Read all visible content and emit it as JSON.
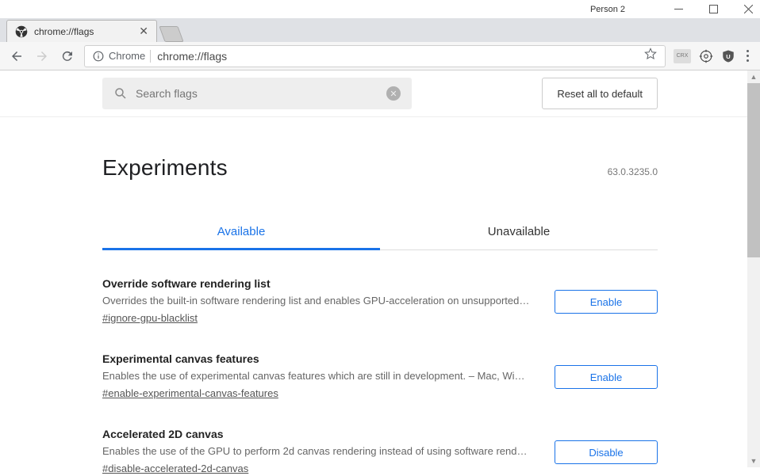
{
  "window": {
    "profile_label": "Person 2"
  },
  "tab": {
    "title": "chrome://flags"
  },
  "addressbar": {
    "origin_label": "Chrome",
    "url": "chrome://flags"
  },
  "search": {
    "placeholder": "Search flags"
  },
  "reset_button": "Reset all to default",
  "page": {
    "heading": "Experiments",
    "version": "63.0.3235.0"
  },
  "tabs": {
    "available": "Available",
    "unavailable": "Unavailable"
  },
  "flags": [
    {
      "title": "Override software rendering list",
      "desc": "Overrides the built-in software rendering list and enables GPU-acceleration on unsupported…",
      "anchor": "#ignore-gpu-blacklist",
      "action": "Enable"
    },
    {
      "title": "Experimental canvas features",
      "desc": "Enables the use of experimental canvas features which are still in development.  – Mac, Wi…",
      "anchor": "#enable-experimental-canvas-features",
      "action": "Enable"
    },
    {
      "title": "Accelerated 2D canvas",
      "desc": "Enables the use of the GPU to perform 2d canvas rendering instead of using software rend…",
      "anchor": "#disable-accelerated-2d-canvas",
      "action": "Disable"
    }
  ]
}
